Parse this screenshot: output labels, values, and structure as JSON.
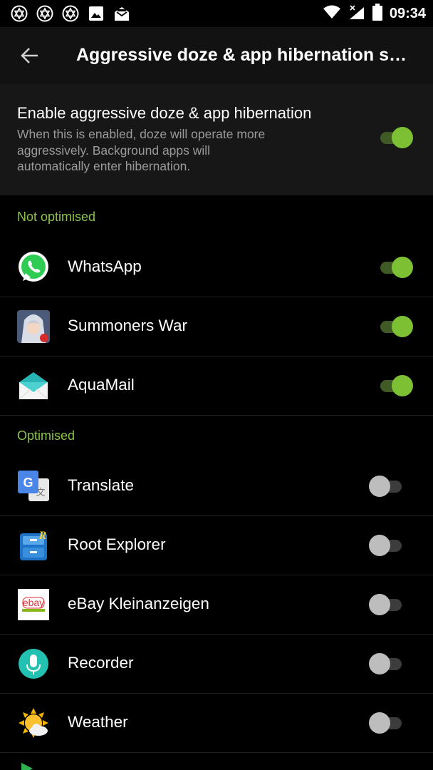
{
  "status_bar": {
    "time": "09:34",
    "left_icons": [
      "hexagram-icon",
      "hexagram-icon",
      "hexagram-icon",
      "image-icon",
      "mail-open-icon"
    ],
    "right_icons": [
      "wifi-icon",
      "signal-icon",
      "battery-icon"
    ]
  },
  "toolbar": {
    "title": "Aggressive doze & app hibernation settings"
  },
  "master": {
    "title": "Enable aggressive doze & app hibernation",
    "subtitle": "When this is enabled, doze will operate more aggressively. Background apps will automatically enter hibernation.",
    "enabled": true
  },
  "sections": {
    "not_optimised": "Not optimised",
    "optimised": "Optimised"
  },
  "not_optimised_apps": [
    {
      "label": "WhatsApp",
      "icon": "whatsapp-icon",
      "enabled": true
    },
    {
      "label": "Summoners War",
      "icon": "summoners-war-icon",
      "enabled": true
    },
    {
      "label": "AquaMail",
      "icon": "aquamail-icon",
      "enabled": true
    }
  ],
  "optimised_apps": [
    {
      "label": "Translate",
      "icon": "translate-icon",
      "enabled": false
    },
    {
      "label": "Root Explorer",
      "icon": "root-explorer-icon",
      "enabled": false
    },
    {
      "label": "eBay Kleinanzeigen",
      "icon": "ebay-kleinanzeigen-icon",
      "enabled": false
    },
    {
      "label": "Recorder",
      "icon": "recorder-icon",
      "enabled": false
    },
    {
      "label": "Weather",
      "icon": "weather-icon",
      "enabled": false
    }
  ],
  "colors": {
    "accent": "#8bc34a",
    "toggle_on": "#7dc034",
    "toggle_off": "#bdbdbd",
    "background": "#000000"
  }
}
